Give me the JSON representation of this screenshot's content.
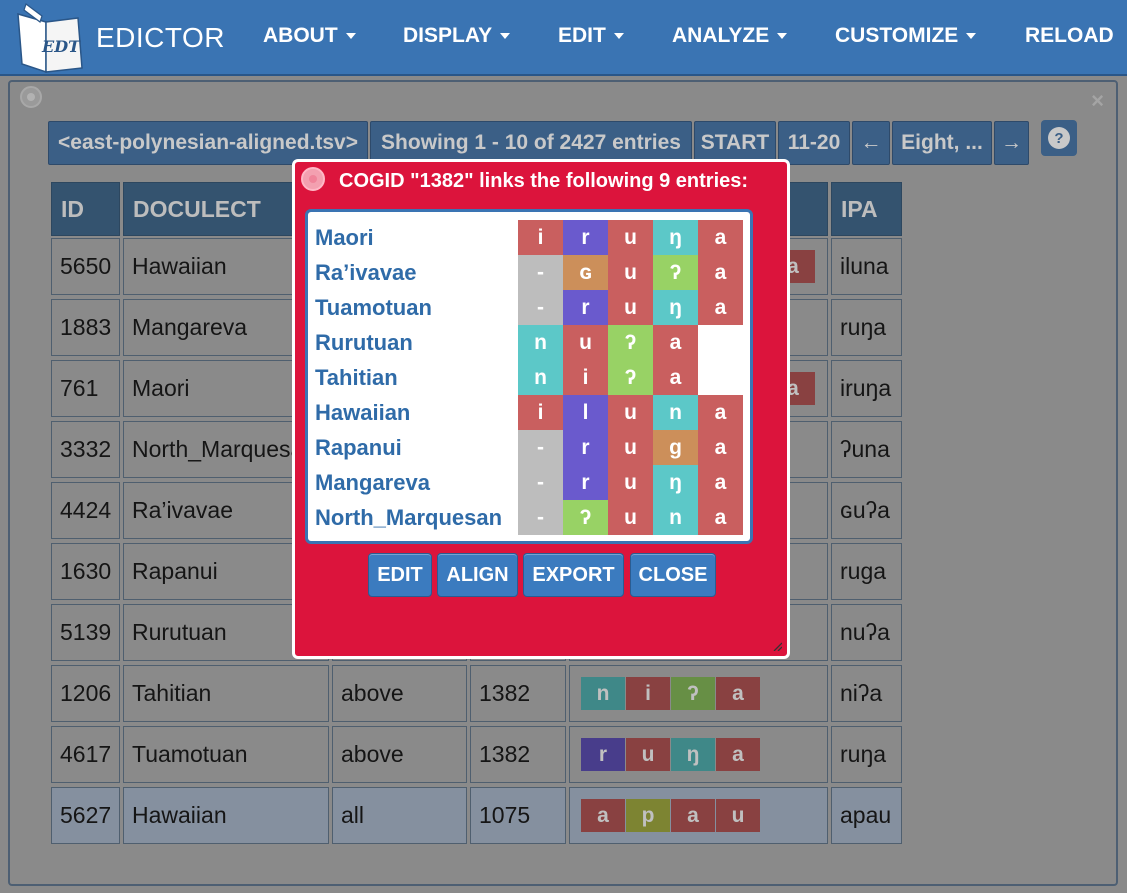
{
  "brand": {
    "name": "EDICTOR",
    "logo_text": "EDT"
  },
  "nav": [
    {
      "label": "ABOUT",
      "dropdown": true
    },
    {
      "label": "DISPLAY",
      "dropdown": true
    },
    {
      "label": "EDIT",
      "dropdown": true
    },
    {
      "label": "ANALYZE",
      "dropdown": true
    },
    {
      "label": "CUSTOMIZE",
      "dropdown": true
    },
    {
      "label": "RELOAD",
      "dropdown": false
    }
  ],
  "panel": {
    "close": "×"
  },
  "toolbar": {
    "file": "<east-polynesian-aligned.tsv>",
    "showing": "Showing 1 - 10 of 2427 entries",
    "start": "START",
    "next_range": "11-20",
    "prev_arrow": "←",
    "concept": "Eight, ...",
    "next_arrow": "→",
    "help": "?"
  },
  "table": {
    "headers": [
      "ID",
      "DOCULECT",
      "",
      "",
      "",
      "IPA"
    ],
    "rows": [
      {
        "id": "5650",
        "doculect": "Hawaiian",
        "concept": "",
        "cogid": "",
        "ipa": "iluna"
      },
      {
        "id": "1883",
        "doculect": "Mangareva",
        "concept": "",
        "cogid": "",
        "ipa": "ruŋa"
      },
      {
        "id": "761",
        "doculect": "Maori",
        "concept": "",
        "cogid": "",
        "ipa": "iruŋa"
      },
      {
        "id": "3332",
        "doculect": "North_Marquesan",
        "concept": "",
        "cogid": "",
        "ipa": "ʔuna"
      },
      {
        "id": "4424",
        "doculect": "Ra’ivavae",
        "concept": "",
        "cogid": "",
        "ipa": "ɢuʔa"
      },
      {
        "id": "1630",
        "doculect": "Rapanui",
        "concept": "",
        "cogid": "",
        "ipa": "ruga"
      },
      {
        "id": "5139",
        "doculect": "Rurutuan",
        "concept": "",
        "cogid": "",
        "ipa": "nuʔa"
      },
      {
        "id": "1206",
        "doculect": "Tahitian",
        "concept": "above",
        "cogid": "1382",
        "ipa": "niʔa"
      },
      {
        "id": "4617",
        "doculect": "Tuamotuan",
        "concept": "above",
        "cogid": "1382",
        "ipa": "ruŋa"
      },
      {
        "id": "5627",
        "doculect": "Hawaiian",
        "concept": "all",
        "cogid": "1075",
        "ipa": "apau"
      }
    ],
    "mini_alignments": {
      "r0_last": "a",
      "r2_last": "a",
      "r7": [
        "n",
        "i",
        "ʔ",
        "a"
      ],
      "r8": [
        "r",
        "u",
        "ŋ",
        "a"
      ],
      "r9": [
        "a",
        "p",
        "a",
        "u"
      ]
    }
  },
  "dialog": {
    "title": "COGID \"1382\" links the following 9 entries:",
    "languages": [
      "Maori",
      "Ra’ivavae",
      "Tuamotuan",
      "Rurutuan",
      "Tahitian",
      "Hawaiian",
      "Rapanui",
      "Mangareva",
      "North_Marquesan"
    ],
    "alignments": [
      [
        "i",
        "r",
        "u",
        "ŋ",
        "a"
      ],
      [
        "-",
        "ɢ",
        "u",
        "ʔ",
        "a"
      ],
      [
        "-",
        "r",
        "u",
        "ŋ",
        "a"
      ],
      [
        "n",
        "u",
        "ʔ",
        "a"
      ],
      [
        "n",
        "i",
        "ʔ",
        "a"
      ],
      [
        "i",
        "l",
        "u",
        "n",
        "a"
      ],
      [
        "-",
        "r",
        "u",
        "g",
        "a"
      ],
      [
        "-",
        "r",
        "u",
        "ŋ",
        "a"
      ],
      [
        "-",
        "ʔ",
        "u",
        "n",
        "a"
      ]
    ],
    "buttons": [
      "EDIT",
      "ALIGN",
      "EXPORT",
      "CLOSE"
    ]
  },
  "colors": {
    "navbar": "#3a74b3",
    "dialog": "#dc143c",
    "segment_classes": {
      "i": "#c95f5f",
      "a": "#c95f5f",
      "r": "#6a5acd",
      "l": "#6a5acd",
      "u": "#c95f5f",
      "ŋ": "#5cc8c8",
      "n": "#5cc8c8",
      "ʔ": "#98d265",
      "ɢ": "#cc8f5a",
      "g": "#cc8f5a",
      "-": "#bdbdbd",
      "p": "#b8c24a"
    }
  }
}
